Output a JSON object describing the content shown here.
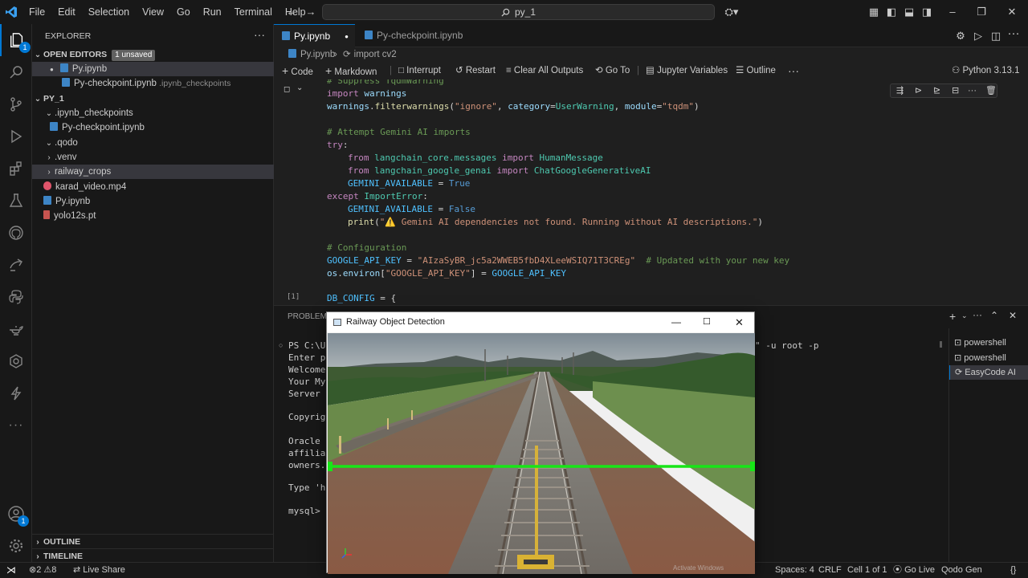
{
  "titlebar": {
    "menu": [
      "File",
      "Edit",
      "Selection",
      "View",
      "Go",
      "Run",
      "Terminal",
      "Help"
    ],
    "search": "py_1"
  },
  "activity": {
    "explorer_badge": "1",
    "accounts_badge": "1"
  },
  "sidebar": {
    "title": "EXPLORER",
    "open_editors": {
      "label": "OPEN EDITORS",
      "badge": "1 unsaved",
      "items": [
        {
          "name": "Py.ipynb",
          "dir": ""
        },
        {
          "name": "Py-checkpoint.ipynb",
          "dir": ".ipynb_checkpoints"
        }
      ]
    },
    "root": "PY_1",
    "tree": [
      ".ipynb_checkpoints",
      "Py-checkpoint.ipynb",
      ".qodo",
      ".venv",
      "railway_crops",
      "karad_video.mp4",
      "Py.ipynb",
      "yolo12s.pt"
    ],
    "outline": "OUTLINE",
    "timeline": "TIMELINE"
  },
  "tabs": [
    {
      "label": "Py.ipynb"
    },
    {
      "label": "Py-checkpoint.ipynb"
    }
  ],
  "breadcrumb": {
    "file": "Py.ipynb",
    "symbol": "import cv2"
  },
  "nbtoolbar": {
    "code": "Code",
    "markdown": "Markdown",
    "interrupt": "Interrupt",
    "restart": "Restart",
    "clear": "Clear All Outputs",
    "goto": "Go To",
    "vars": "Jupyter Variables",
    "outline": "Outline",
    "kernel": "Python 3.13.1"
  },
  "cell": {
    "exec_count": "[1]"
  },
  "code": {
    "l1": "# Suppress TqdmWarning",
    "l2a": "import",
    "l2b": " warnings",
    "l3a": "warnings",
    "l3b": ".",
    "l3c": "filterwarnings",
    "l3d": "(",
    "l3e": "\"ignore\"",
    "l3f": ", ",
    "l3g": "category",
    "l3h": "=",
    "l3i": "UserWarning",
    "l3j": ", ",
    "l3k": "module",
    "l3l": "=",
    "l3m": "\"tqdm\"",
    "l3n": ")",
    "l5": "# Attempt Gemini AI imports",
    "l6a": "try",
    ":": ":",
    "l7a": "from",
    "l7b": " langchain_core.messages ",
    "l7c": "import",
    "l7d": " HumanMessage",
    "l8a": "from",
    "l8b": " langchain_google_genai ",
    "l8c": "import",
    "l8d": " ChatGoogleGenerativeAI",
    "l9a": "GEMINI_AVAILABLE",
    "l9b": " = ",
    "l9c": "True",
    "l10a": "except",
    "l10b": " ImportError",
    "l10c": ":",
    "l11a": "GEMINI_AVAILABLE",
    "l11b": " = ",
    "l11c": "False",
    "l12a": "print",
    "l12b": "(",
    "l12c": "\"⚠️ Gemini AI dependencies not found. Running without AI descriptions.\"",
    "l12d": ")",
    "l14": "# Configuration",
    "l15a": "GOOGLE_API_KEY",
    "l15b": " = ",
    "l15c": "\"AIzaSyBR_jc5a2WWEB5fbD4XLeeWSIQ71T3CREg\"",
    "l15d": "  # Updated with your new key",
    "l16a": "os",
    "l16b": ".",
    "l16c": "environ",
    "l16d": "[",
    "l16e": "\"GOOGLE_API_KEY\"",
    "l16f": "] = ",
    "l16g": "GOOGLE_API_KEY",
    "l18a": "DB_CONFIG",
    "l18b": " = {"
  },
  "panel": {
    "tab": "PROBLEMS",
    "lines": [
      "PS C:\\Us",
      "Enter pa",
      "Welcome ",
      "Your MyS",
      "Server v",
      "",
      "Copyrigh",
      "",
      "Oracle i",
      "affiliat",
      "owners.",
      "",
      "Type 'he",
      "",
      "mysql> "
    ],
    "cmd_tail": "\" -u root -p",
    "terminals": [
      "powershell",
      "powershell",
      "EasyCode AI"
    ]
  },
  "status": {
    "errors": "2",
    "warnings": "8",
    "liveshare": "Live Share",
    "spaces": "Spaces: 4",
    "eol": "CRLF",
    "cell": "Cell 1 of 1",
    "golive": "Go Live",
    "qodo": "Qodo Gen",
    "braces": "{}"
  },
  "popup": {
    "title": "Railway Object Detection",
    "watermark": "Activate Windows"
  }
}
